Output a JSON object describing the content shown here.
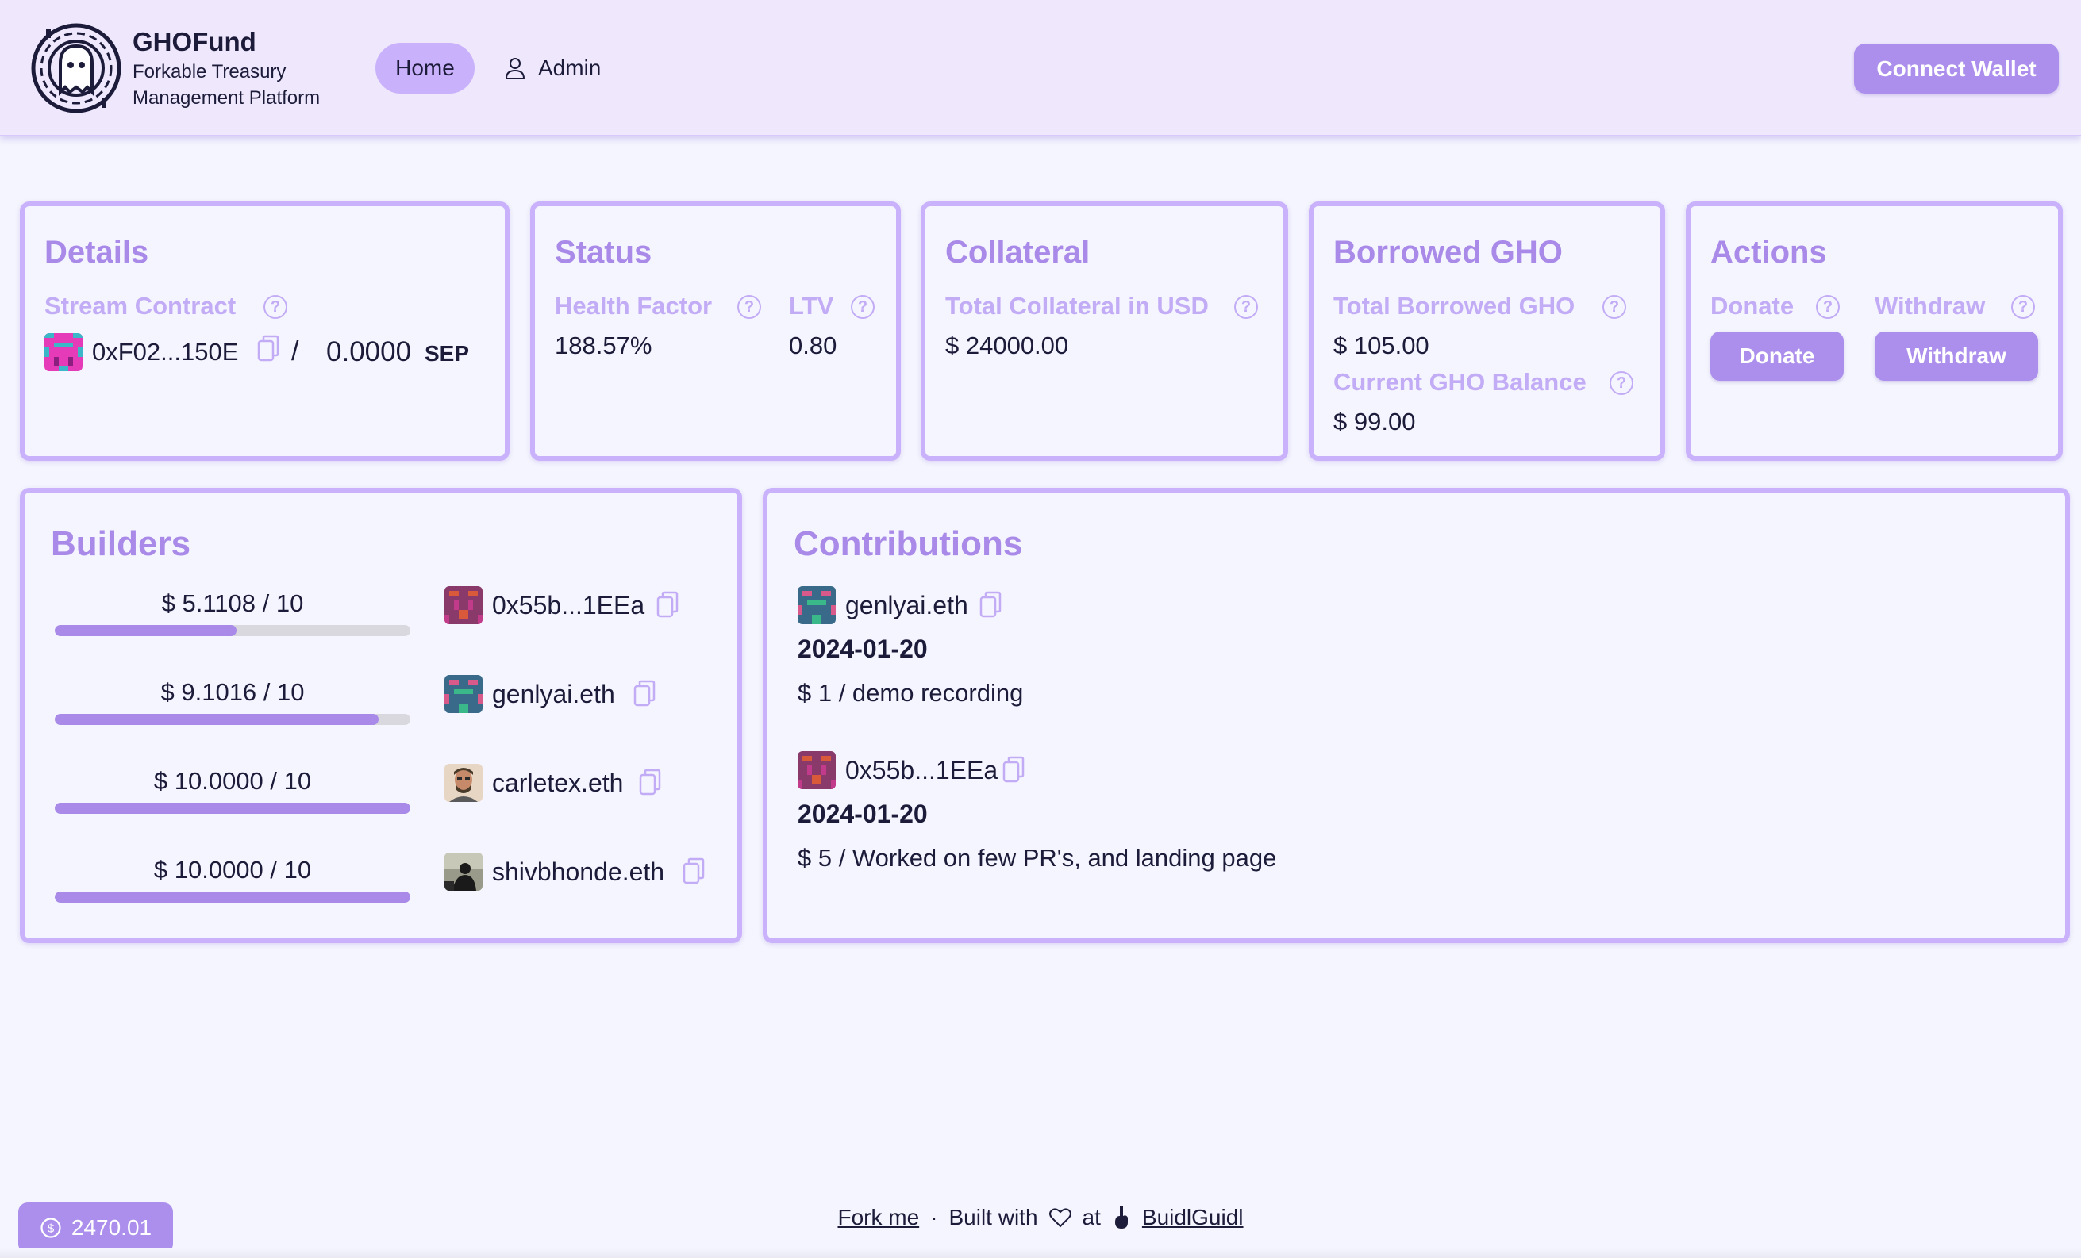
{
  "header": {
    "brand_title": "GHOFund",
    "brand_subtitle": "Forkable Treasury Management Platform",
    "nav_home": "Home",
    "nav_admin": "Admin",
    "connect_wallet": "Connect Wallet"
  },
  "details": {
    "title": "Details",
    "stream_contract_label": "Stream Contract",
    "address": "0xF02...150E",
    "separator": "/",
    "balance": "0.0000",
    "unit": "SEP"
  },
  "status": {
    "title": "Status",
    "health_factor_label": "Health Factor",
    "health_factor_value": "188.57%",
    "ltv_label": "LTV",
    "ltv_value": "0.80"
  },
  "collateral": {
    "title": "Collateral",
    "total_label": "Total Collateral in USD",
    "total_value": "$ 24000.00"
  },
  "borrowed": {
    "title": "Borrowed GHO",
    "total_label": "Total Borrowed GHO",
    "total_value": "$ 105.00",
    "balance_label": "Current GHO Balance",
    "balance_value": "$ 99.00"
  },
  "actions": {
    "title": "Actions",
    "donate_label": "Donate",
    "withdraw_label": "Withdraw",
    "donate_button": "Donate",
    "withdraw_button": "Withdraw"
  },
  "builders": {
    "title": "Builders",
    "items": [
      {
        "amount": "$ 5.1108 / 10",
        "progress": 0.511,
        "name": "0x55b...1EEa"
      },
      {
        "amount": "$ 9.1016 / 10",
        "progress": 0.91,
        "name": "genlyai.eth"
      },
      {
        "amount": "$ 10.0000 / 10",
        "progress": 1.0,
        "name": "carletex.eth"
      },
      {
        "amount": "$ 10.0000 / 10",
        "progress": 1.0,
        "name": "shivbhonde.eth"
      }
    ]
  },
  "contributions": {
    "title": "Contributions",
    "items": [
      {
        "name": "genlyai.eth",
        "date": "2024-01-20",
        "desc": "$ 1 / demo recording"
      },
      {
        "name": "0x55b...1EEa",
        "date": "2024-01-20",
        "desc": "$ 5 / Worked on few PR's, and landing page"
      }
    ]
  },
  "footer": {
    "balance": "2470.01",
    "fork_me": "Fork me",
    "dot": "·",
    "built_with": "Built with",
    "at": "at",
    "buidlguidl": "BuidlGuidl"
  },
  "icons": {
    "help": "question-circle-icon",
    "copy": "copy-icon",
    "user": "user-icon",
    "heart": "heart-icon",
    "dollar": "dollar-circle-icon"
  },
  "colors": {
    "accent": "#ac8fec",
    "card_border": "#c9b2fb",
    "label": "#c3acf6",
    "title": "#a98ae8",
    "header_bg": "#efe8fd",
    "page_bg": "#f4f5fe"
  }
}
